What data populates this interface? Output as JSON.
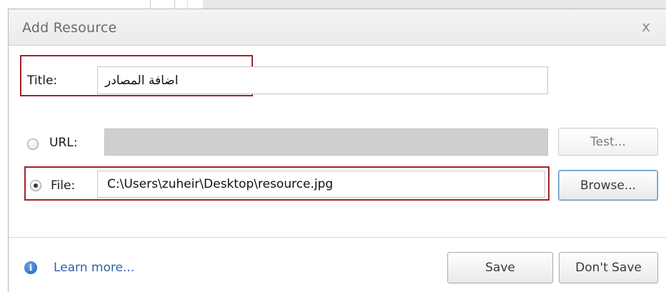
{
  "dialog": {
    "title": "Add Resource",
    "close_glyph": "x"
  },
  "form": {
    "title_label": "Title:",
    "title_value": "اضافة المصادر",
    "url_label": "URL:",
    "url_value": "",
    "url_selected": false,
    "test_button": "Test...",
    "file_label": "File:",
    "file_value": "C:\\Users\\zuheir\\Desktop\\resource.jpg",
    "file_selected": true,
    "browse_button": "Browse..."
  },
  "footer": {
    "info_icon": "info-icon",
    "info_glyph": "i",
    "learn_more": "Learn more...",
    "save_button": "Save",
    "dont_save_button": "Don't Save"
  },
  "colors": {
    "highlight_box": "#a0232b",
    "link": "#2f62a8",
    "disabled_field": "#cfcfcf"
  }
}
